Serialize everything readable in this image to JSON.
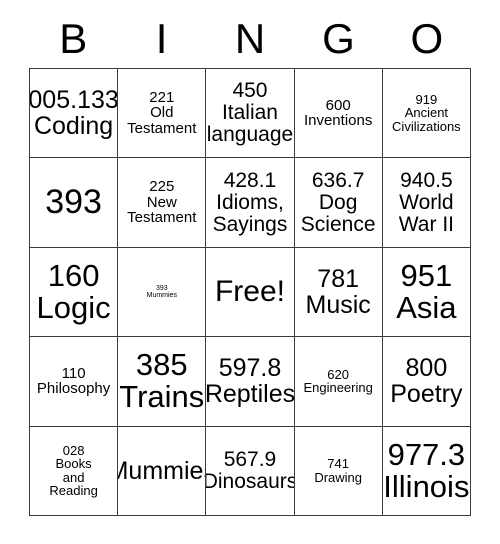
{
  "card": {
    "header": {
      "letters": [
        "B",
        "I",
        "N",
        "G",
        "O"
      ]
    },
    "rows": [
      [
        {
          "number": "005.133",
          "label": "Coding",
          "size": "lg"
        },
        {
          "number": "221",
          "label": "Old\nTestament",
          "size": "sm"
        },
        {
          "number": "450",
          "label": "Italian\nlanguage",
          "size": "md"
        },
        {
          "number": "600",
          "label": "Inventions",
          "size": "sm"
        },
        {
          "number": "919",
          "label": "Ancient\nCivilizations",
          "size": "xs"
        }
      ],
      [
        {
          "number": "393",
          "label": "",
          "size": "num-only"
        },
        {
          "number": "225",
          "label": "New\nTestament",
          "size": "sm"
        },
        {
          "number": "428.1",
          "label": "Idioms,\nSayings",
          "size": "md"
        },
        {
          "number": "636.7",
          "label": "Dog\nScience",
          "size": "md"
        },
        {
          "number": "940.5",
          "label": "World\nWar II",
          "size": "md"
        }
      ],
      [
        {
          "number": "160",
          "label": "Logic",
          "size": "xl"
        },
        {
          "number": "393",
          "label": "Mummies",
          "size": "tiny"
        },
        {
          "number": "",
          "label": "Free!",
          "size": "free"
        },
        {
          "number": "781",
          "label": "Music",
          "size": "lg"
        },
        {
          "number": "951",
          "label": "Asia",
          "size": "xl"
        }
      ],
      [
        {
          "number": "110",
          "label": "Philosophy",
          "size": "sm"
        },
        {
          "number": "385",
          "label": "Trains",
          "size": "xl"
        },
        {
          "number": "597.8",
          "label": "Reptiles",
          "size": "lg"
        },
        {
          "number": "620",
          "label": "Engineering",
          "size": "xs"
        },
        {
          "number": "800",
          "label": "Poetry",
          "size": "lg"
        }
      ],
      [
        {
          "number": "028",
          "label": "Books\nand\nReading",
          "size": "xs"
        },
        {
          "number": "",
          "label": "Mummies",
          "size": "lg"
        },
        {
          "number": "567.9",
          "label": "Dinosaurs",
          "size": "md"
        },
        {
          "number": "741",
          "label": "Drawing",
          "size": "xs"
        },
        {
          "number": "977.3",
          "label": "Illinois",
          "size": "xl"
        }
      ]
    ]
  },
  "colors": {
    "background": "#ffffff",
    "text": "#000000",
    "grid_line": "#3b3b3b"
  }
}
